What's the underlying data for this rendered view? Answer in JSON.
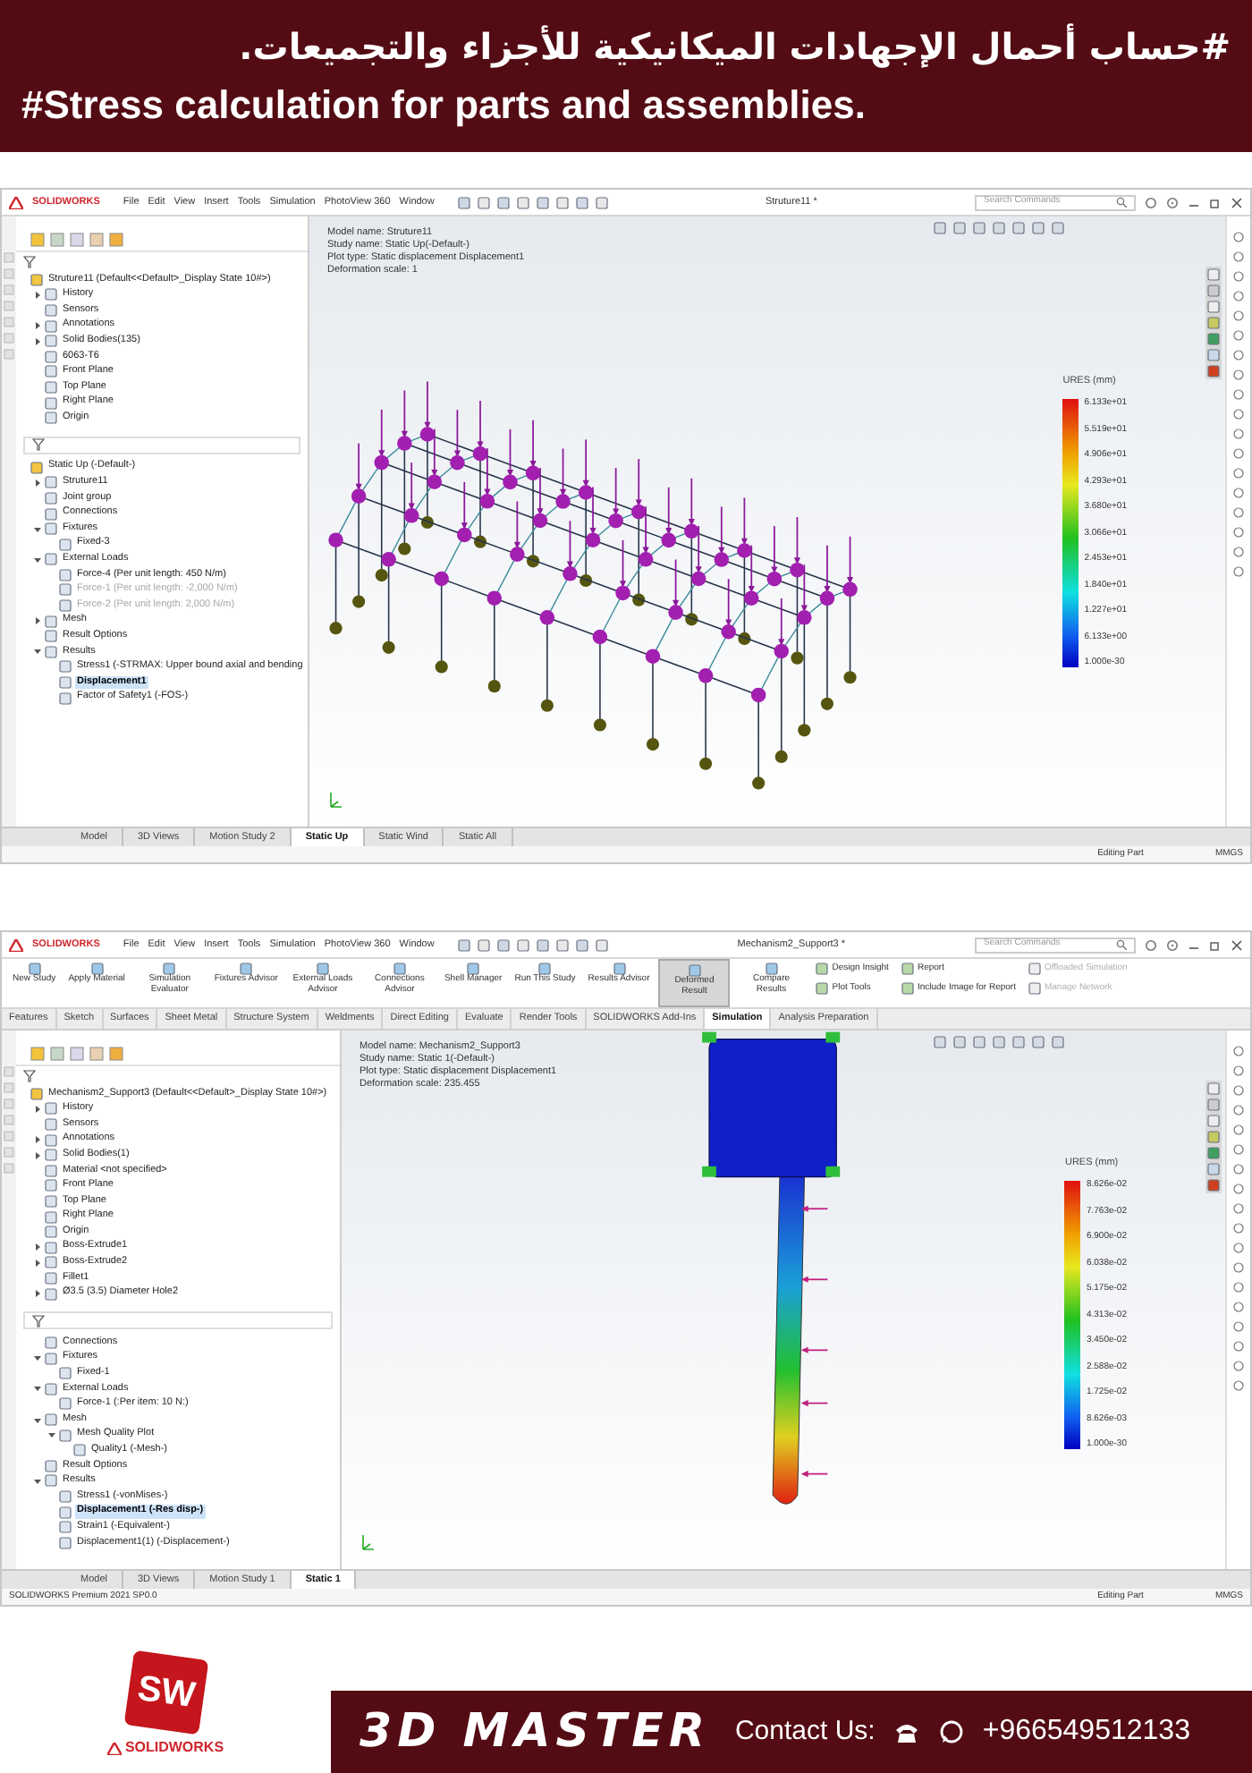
{
  "header": {
    "title_ar": "#حساب أحمال الإجهادات الميكانيكية للأجزاء والتجميعات.",
    "title_en": "#Stress calculation for parts and assemblies."
  },
  "screens": [
    {
      "kind": "frame",
      "app_name": "SOLIDWORKS",
      "menu": [
        "File",
        "Edit",
        "View",
        "Insert",
        "Tools",
        "Simulation",
        "PhotoView 360",
        "Window"
      ],
      "document_title": "Struture11 *",
      "search": {
        "placeholder": "Search Commands"
      },
      "feature_tree": [
        {
          "label": "Struture11  (Default<<Default>_Display State 10#>)",
          "selected": false,
          "children": [
            {
              "label": "History",
              "selected": false,
              "expanded": false
            },
            {
              "label": "Sensors",
              "selected": false
            },
            {
              "label": "Annotations",
              "selected": false,
              "expanded": false
            },
            {
              "label": "Solid Bodies(135)",
              "selected": false,
              "expanded": false
            },
            {
              "label": "6063-T6",
              "selected": false
            },
            {
              "label": "Front Plane",
              "selected": false
            },
            {
              "label": "Top Plane",
              "selected": false
            },
            {
              "label": "Right Plane",
              "selected": false
            },
            {
              "label": "Origin",
              "selected": false
            }
          ]
        }
      ],
      "study_tree": [
        {
          "label": "Static Up (-Default-)",
          "selected": false,
          "children": [
            {
              "label": "Struture11",
              "selected": false,
              "expanded": false
            },
            {
              "label": "Joint group",
              "selected": false
            },
            {
              "label": "Connections",
              "selected": false
            },
            {
              "label": "Fixtures",
              "selected": false,
              "expanded": true,
              "children": [
                {
                  "label": "Fixed-3",
                  "selected": false
                }
              ]
            },
            {
              "label": "External Loads",
              "selected": false,
              "expanded": true,
              "children": [
                {
                  "label": "Force-4 (Per unit length: 450 N/m)",
                  "selected": false,
                  "disabled": false
                },
                {
                  "label": "Force-1 (Per unit length: -2,000 N/m)",
                  "selected": false,
                  "disabled": true
                },
                {
                  "label": "Force-2 (Per unit length: 2,000 N/m)",
                  "selected": false,
                  "disabled": true
                }
              ]
            },
            {
              "label": "Mesh",
              "selected": false,
              "expanded": false
            },
            {
              "label": "Result Options",
              "selected": false
            },
            {
              "label": "Results",
              "selected": false,
              "expanded": true,
              "children": [
                {
                  "label": "Stress1 (-STRMAX: Upper bound axial and bending",
                  "selected": false
                },
                {
                  "label": "Displacement1",
                  "selected": true
                },
                {
                  "label": "Factor of Safety1 (-FOS-)",
                  "selected": false
                }
              ]
            }
          ]
        }
      ],
      "viewport": {
        "info": [
          "Model name: Struture11",
          "Study name: Static Up(-Default-)",
          "Plot type: Static displacement Displacement1",
          "Deformation scale: 1"
        ],
        "legend": {
          "title": "URES (mm)",
          "labels": [
            "6.133e+01",
            "5.519e+01",
            "4.906e+01",
            "4.293e+01",
            "3.680e+01",
            "3.066e+01",
            "2.453e+01",
            "1.840e+01",
            "1.227e+01",
            "6.133e+00",
            "1.000e-30"
          ]
        }
      },
      "bottom_tabs": [
        {
          "label": "Model",
          "selected": false
        },
        {
          "label": "3D Views",
          "selected": false
        },
        {
          "label": "Motion Study 2",
          "selected": false
        },
        {
          "label": "Static Up",
          "selected": true
        },
        {
          "label": "Static Wind",
          "selected": false
        },
        {
          "label": "Static All",
          "selected": false
        }
      ],
      "status_bar": [
        "Editing Part",
        "MMGS"
      ]
    },
    {
      "kind": "part",
      "app_name": "SOLIDWORKS",
      "menu": [
        "File",
        "Edit",
        "View",
        "Insert",
        "Tools",
        "Simulation",
        "PhotoView 360",
        "Window"
      ],
      "document_title": "Mechanism2_Support3 *",
      "search": {
        "placeholder": "Search Commands"
      },
      "ribbon": {
        "buttons": [
          {
            "label": "New Study",
            "kind": "large",
            "selected": false,
            "disabled": false
          },
          {
            "label": "Apply Material",
            "kind": "large",
            "selected": false,
            "disabled": false
          },
          {
            "label": "Simulation Evaluator",
            "kind": "large",
            "selected": false,
            "disabled": false
          },
          {
            "label": "Fixtures Advisor",
            "kind": "large",
            "selected": false,
            "disabled": false
          },
          {
            "label": "External Loads Advisor",
            "kind": "large",
            "selected": false,
            "disabled": false
          },
          {
            "label": "Connections Advisor",
            "kind": "large",
            "selected": false,
            "disabled": false
          },
          {
            "label": "Shell Manager",
            "kind": "large",
            "selected": false,
            "disabled": false
          },
          {
            "label": "Run This Study",
            "kind": "large",
            "selected": false,
            "disabled": false
          },
          {
            "label": "Results Advisor",
            "kind": "large",
            "selected": false,
            "disabled": false
          },
          {
            "label": "Deformed Result",
            "kind": "large",
            "selected": true,
            "disabled": false
          },
          {
            "label": "Compare Results",
            "kind": "large",
            "selected": false,
            "disabled": false
          },
          {
            "label": "Design Insight",
            "kind": "small",
            "selected": false,
            "disabled": false
          },
          {
            "label": "Plot Tools",
            "kind": "small",
            "selected": false,
            "disabled": false
          },
          {
            "label": "Report",
            "kind": "small",
            "selected": false,
            "disabled": false
          },
          {
            "label": "Include Image for Report",
            "kind": "small",
            "selected": false,
            "disabled": false
          },
          {
            "label": "Offloaded Simulation",
            "kind": "small",
            "selected": false,
            "disabled": true
          },
          {
            "label": "Manage Network",
            "kind": "small",
            "selected": false,
            "disabled": true
          }
        ],
        "tabs": [
          {
            "label": "Features",
            "selected": false
          },
          {
            "label": "Sketch",
            "selected": false
          },
          {
            "label": "Surfaces",
            "selected": false
          },
          {
            "label": "Sheet Metal",
            "selected": false
          },
          {
            "label": "Structure System",
            "selected": false
          },
          {
            "label": "Weldments",
            "selected": false
          },
          {
            "label": "Direct Editing",
            "selected": false
          },
          {
            "label": "Evaluate",
            "selected": false
          },
          {
            "label": "Render Tools",
            "selected": false
          },
          {
            "label": "SOLIDWORKS Add-Ins",
            "selected": false
          },
          {
            "label": "Simulation",
            "selected": true
          },
          {
            "label": "Analysis Preparation",
            "selected": false
          }
        ]
      },
      "feature_tree": [
        {
          "label": "Mechanism2_Support3  (Default<<Default>_Display State 10#>)",
          "selected": false,
          "children": [
            {
              "label": "History",
              "selected": false,
              "expanded": false
            },
            {
              "label": "Sensors",
              "selected": false
            },
            {
              "label": "Annotations",
              "selected": false,
              "expanded": false
            },
            {
              "label": "Solid Bodies(1)",
              "selected": false,
              "expanded": false
            },
            {
              "label": "Material <not specified>",
              "selected": false
            },
            {
              "label": "Front Plane",
              "selected": false
            },
            {
              "label": "Top Plane",
              "selected": false
            },
            {
              "label": "Right Plane",
              "selected": false
            },
            {
              "label": "Origin",
              "selected": false
            },
            {
              "label": "Boss-Extrude1",
              "selected": false,
              "expanded": false
            },
            {
              "label": "Boss-Extrude2",
              "selected": false,
              "expanded": false
            },
            {
              "label": "Fillet1",
              "selected": false
            },
            {
              "label": "Ø3.5 (3.5) Diameter Hole2",
              "selected": false,
              "expanded": false
            }
          ]
        }
      ],
      "study_tree": [
        {
          "label": "Connections",
          "selected": false
        },
        {
          "label": "Fixtures",
          "selected": false,
          "expanded": true,
          "children": [
            {
              "label": "Fixed-1",
              "selected": false
            }
          ]
        },
        {
          "label": "External Loads",
          "selected": false,
          "expanded": true,
          "children": [
            {
              "label": "Force-1 (:Per item: 10 N:)",
              "selected": false
            }
          ]
        },
        {
          "label": "Mesh",
          "selected": false,
          "expanded": true,
          "children": [
            {
              "label": "Mesh Quality Plot",
              "selected": false,
              "expanded": true,
              "children": [
                {
                  "label": "Quality1 (-Mesh-)",
                  "selected": false
                }
              ]
            }
          ]
        },
        {
          "label": "Result Options",
          "selected": false
        },
        {
          "label": "Results",
          "selected": false,
          "expanded": true,
          "children": [
            {
              "label": "Stress1 (-vonMises-)",
              "selected": false
            },
            {
              "label": "Displacement1 (-Res disp-)",
              "selected": true
            },
            {
              "label": "Strain1 (-Equivalent-)",
              "selected": false
            },
            {
              "label": "Displacement1(1) (-Displacement-)",
              "selected": false
            }
          ]
        }
      ],
      "viewport": {
        "info": [
          "Model name: Mechanism2_Support3",
          "Study name: Static 1(-Default-)",
          "Plot type: Static displacement Displacement1",
          "Deformation scale: 235.455"
        ],
        "legend": {
          "title": "URES (mm)",
          "labels": [
            "8.626e-02",
            "7.763e-02",
            "6.900e-02",
            "6.038e-02",
            "5.175e-02",
            "4.313e-02",
            "3.450e-02",
            "2.588e-02",
            "1.725e-02",
            "8.626e-03",
            "1.000e-30"
          ]
        }
      },
      "bottom_tabs": [
        {
          "label": "Model",
          "selected": false
        },
        {
          "label": "3D Views",
          "selected": false
        },
        {
          "label": "Motion Study 1",
          "selected": false
        },
        {
          "label": "Static 1",
          "selected": true
        }
      ],
      "status_bar": [
        "SOLIDWORKS Premium 2021 SP0.0",
        "Editing Part",
        "MMGS"
      ]
    }
  ],
  "footer": {
    "logo": {
      "letters": "SW",
      "brand": "SOLIDWORKS"
    },
    "brand_name": "3D MASTER",
    "contact_label": "Contact Us:",
    "phone": "+966549512133"
  }
}
